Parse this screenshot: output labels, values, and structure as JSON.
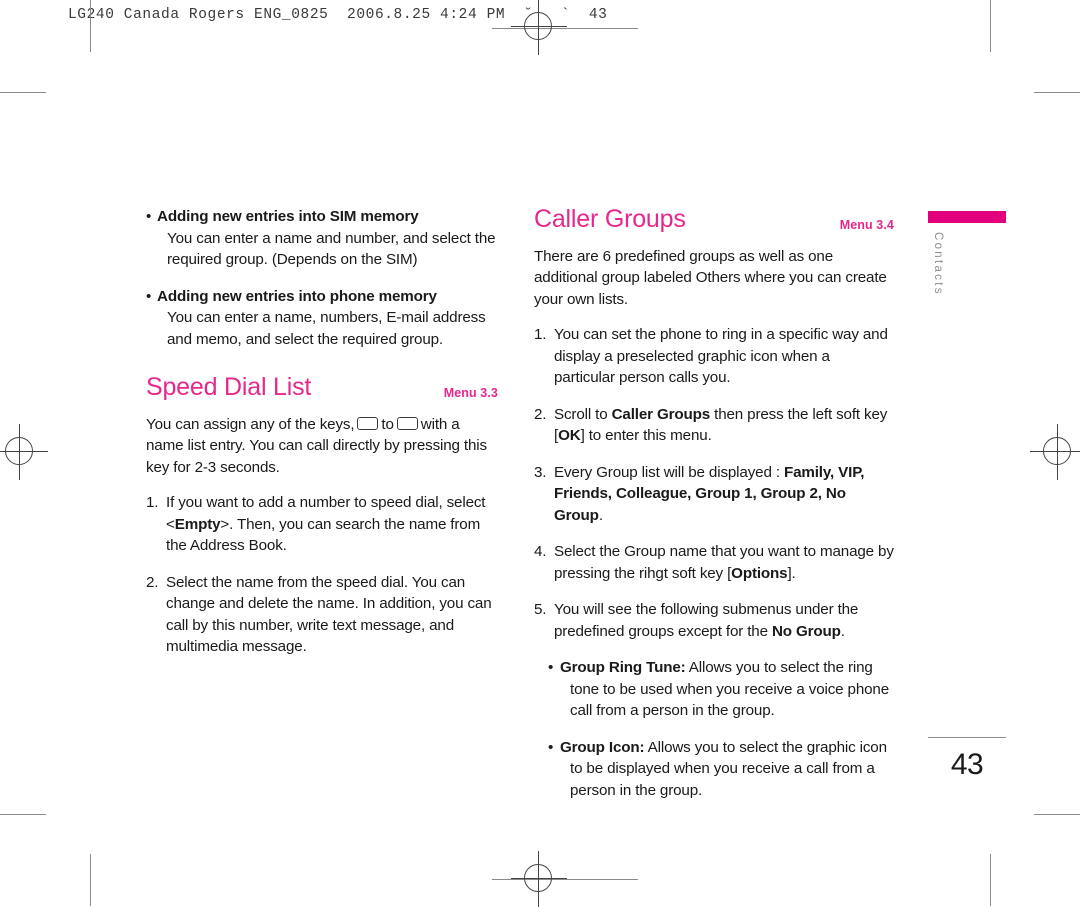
{
  "prepress": {
    "header_line": "LG240 Canada Rogers ENG_0825  2006.8.25 4:24 PM  ˘   `  43"
  },
  "tab": {
    "label": "Contacts",
    "bar_color": "#E3007F"
  },
  "folio": {
    "page_number": "43"
  },
  "colors": {
    "heading_pink": "#E6288C",
    "tab_pink": "#E3007F",
    "body_text": "#1a1a1a",
    "tab_label_gray": "#8e8e8e"
  },
  "left_column": {
    "intro_bullets": [
      {
        "bullet": "•",
        "lead": "Adding new entries into SIM memory",
        "body": "You can enter a name and number, and select the required group. (Depends on the SIM)"
      },
      {
        "bullet": "•",
        "lead": "Adding new entries into phone memory",
        "body": "You can enter a name, numbers, E-mail address and memo, and select the required group."
      }
    ],
    "section": {
      "title": "Speed Dial List",
      "menu_ref": "Menu 3.3",
      "intro_part1": "You can assign any of the keys,",
      "intro_between": "to",
      "intro_part2": "with a name list entry. You can call directly by pressing this key for 2-3 seconds.",
      "steps": [
        {
          "num": "1.",
          "pre": "If you want to add a number to speed dial, select <",
          "bold": "Empty",
          "post": ">. Then, you can search the name from the Address Book."
        },
        {
          "num": "2.",
          "pre": "Select the name from the speed dial. You can change and delete the name. In addition, you can call by this number, write text message, and multimedia message.",
          "bold": "",
          "post": ""
        }
      ]
    }
  },
  "right_column": {
    "section": {
      "title": "Caller Groups",
      "menu_ref": "Menu 3.4",
      "intro": "There are 6 predefined groups as well as one additional group labeled Others where you can create your own lists.",
      "steps": [
        {
          "num": "1.",
          "text": "You can set the phone to ring in a specific way and display a preselected graphic icon when a particular person calls you."
        },
        {
          "num": "2.",
          "text_a": "Scroll to ",
          "bold_a": "Caller Groups",
          "text_b": " then press the left soft key [",
          "bold_b": "OK",
          "text_c": "] to enter this menu."
        },
        {
          "num": "3.",
          "text_a": "Every Group list will be displayed : ",
          "groups": "Family, VIP, Friends, Colleague, Group 1, Group 2, No Group",
          "text_b": "."
        },
        {
          "num": "4.",
          "text_a": "Select the Group name that you want to manage by pressing the rihgt soft key [",
          "bold_a": "Options",
          "text_b": "]."
        },
        {
          "num": "5.",
          "text_a": "You will see the following submenus under the predefined groups except for the ",
          "bold_a": "No Group",
          "text_b": "."
        }
      ],
      "submenu_bullets": [
        {
          "bullet": "•",
          "lead": "Group Ring Tune:",
          "body": " Allows you to select the ring tone to be used when you receive a voice phone call from a person in the group."
        },
        {
          "bullet": "•",
          "lead": "Group Icon:",
          "body": " Allows you to select the graphic icon to be displayed when you receive a call from a person in the group."
        }
      ]
    }
  }
}
